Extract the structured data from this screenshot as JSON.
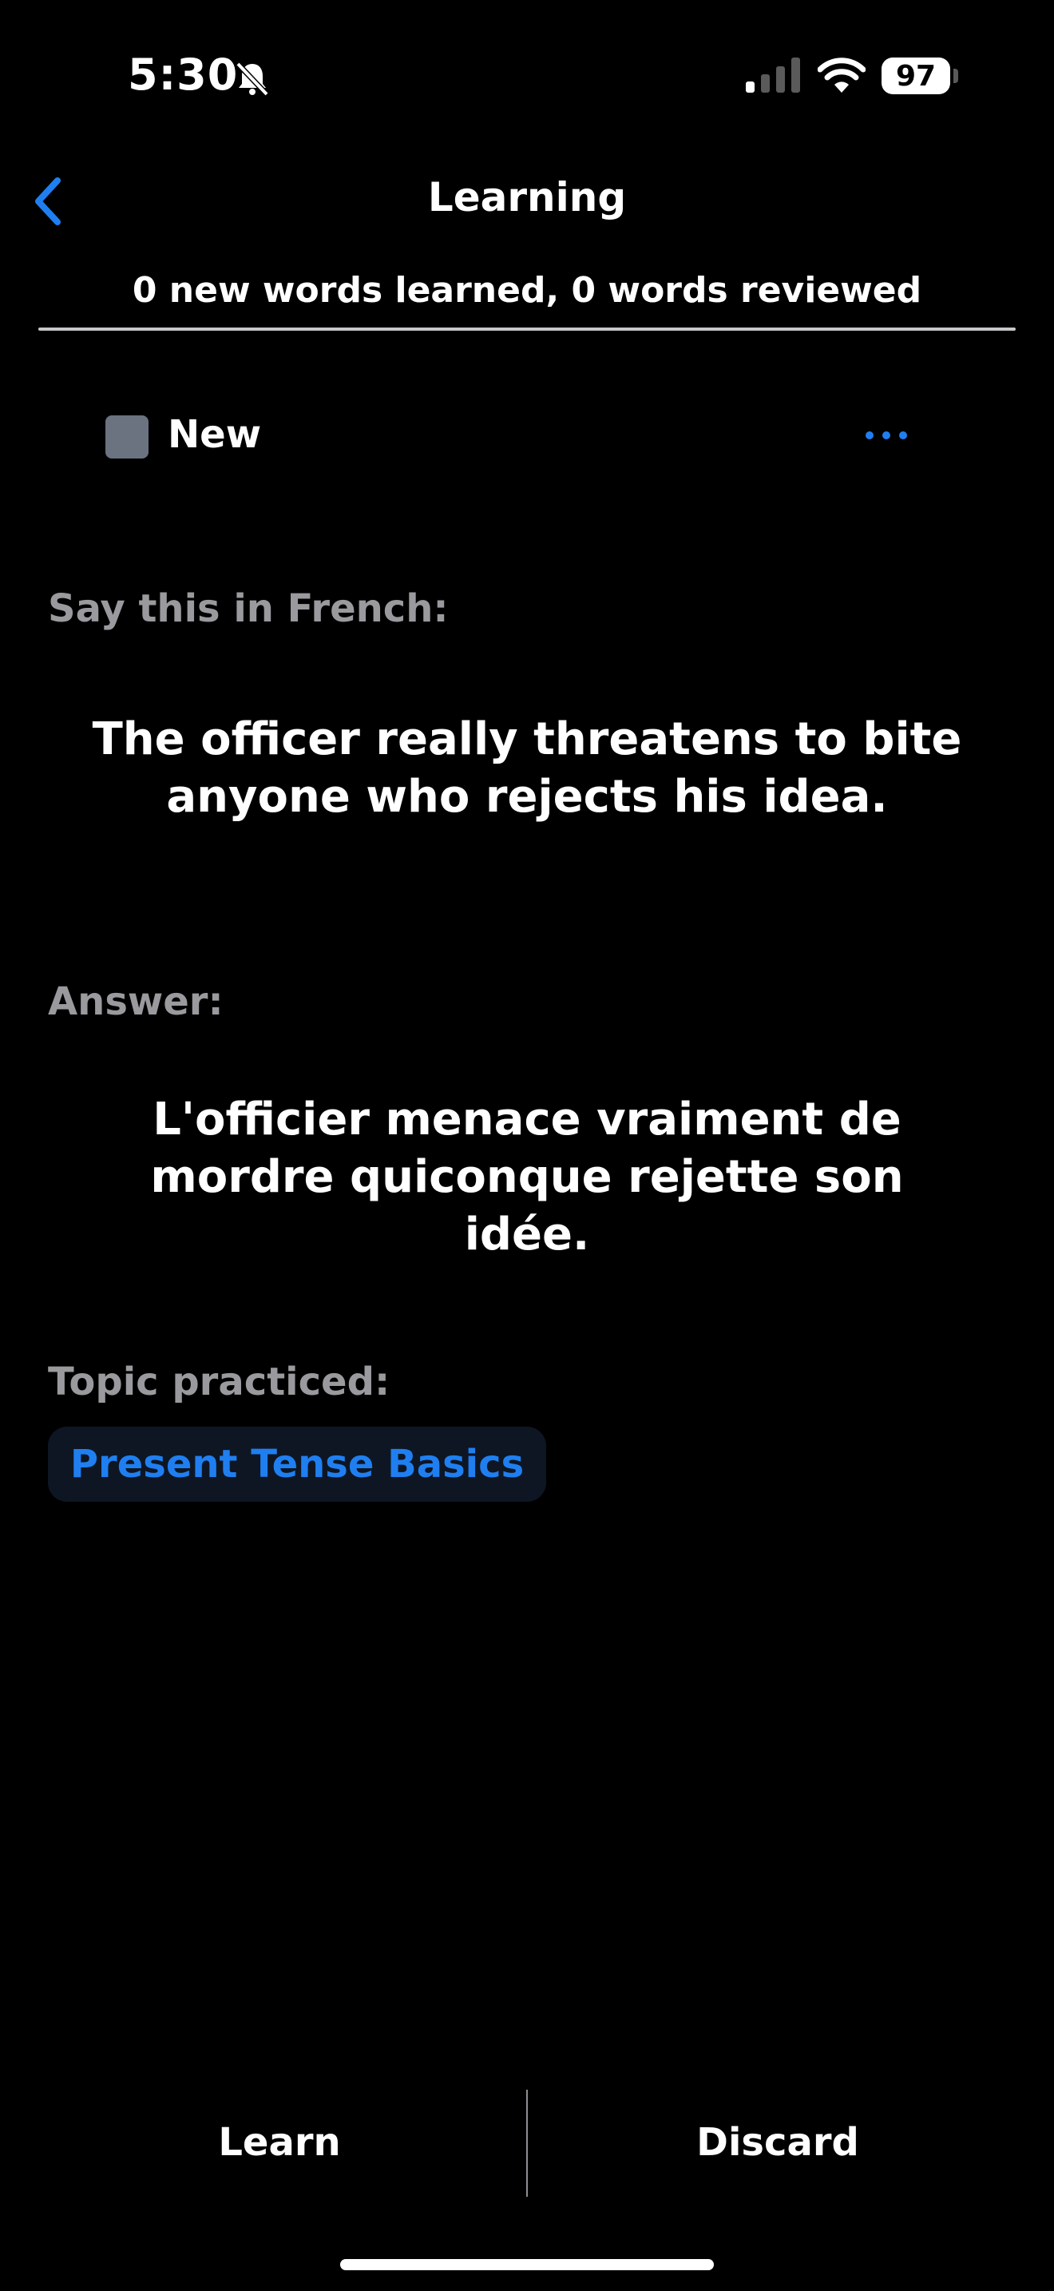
{
  "status_bar": {
    "time": "5:30",
    "battery": "97"
  },
  "nav": {
    "title": "Learning",
    "progress": "0 new words learned, 0 words reviewed"
  },
  "card": {
    "status_label": "New",
    "prompt_label": "Say this in French:",
    "prompt_line1": "The officer really threatens to bite",
    "prompt_line2": "anyone who rejects his idea.",
    "answer_label": "Answer:",
    "answer_line1": "L'officier menace vraiment de",
    "answer_line2": "mordre quiconque rejette son",
    "answer_line3": "idée.",
    "topic_label": "Topic practiced:",
    "topic": "Present Tense Basics"
  },
  "actions": {
    "learn_label": "Learn",
    "discard_label": "Discard"
  },
  "colors": {
    "accent": "#1f7ff0",
    "muted_text": "#9a9a9e",
    "background": "#000000"
  }
}
